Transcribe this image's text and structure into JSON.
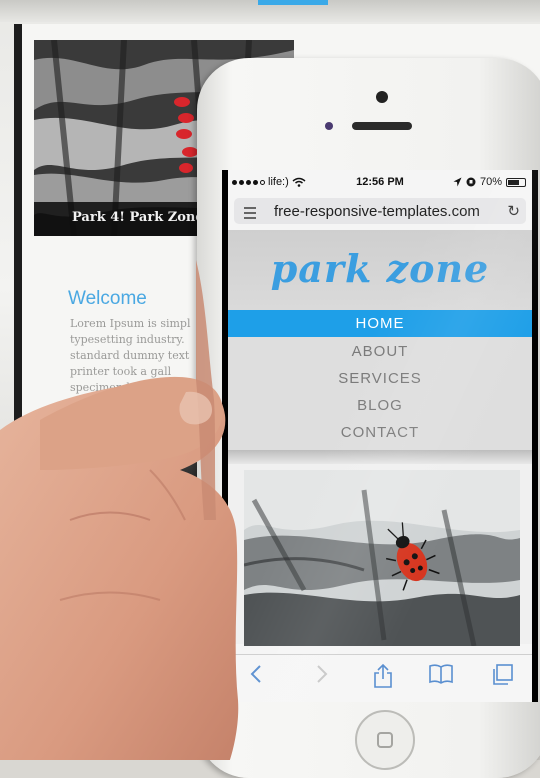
{
  "background_monitor": {
    "photo_caption": "Park 4! Park Zone d",
    "welcome_heading": "Welcome",
    "lorem_lines": [
      "Lorem Ipsum is simpl",
      "typesetting industry.",
      "standard dummy text",
      "printer took a gall",
      "specimen b"
    ]
  },
  "phone": {
    "status_bar": {
      "carrier": "life:)",
      "time": "12:56 PM",
      "battery": "70%",
      "battery_level": 0.7,
      "signal_bars": 4
    },
    "address_bar": {
      "url": "free-responsive-templates.com"
    },
    "site": {
      "logo": "park zone",
      "nav": [
        {
          "label": "HOME",
          "active": true
        },
        {
          "label": "ABOUT",
          "active": false
        },
        {
          "label": "SERVICES",
          "active": false
        },
        {
          "label": "BLOG",
          "active": false
        },
        {
          "label": "CONTACT",
          "active": false
        }
      ]
    },
    "toolbar_icons": [
      "back-icon",
      "forward-icon",
      "share-icon",
      "bookmarks-icon",
      "tabs-icon"
    ]
  },
  "colors": {
    "accent_blue": "#1e9fe8",
    "logo_blue": "#3b9ee0",
    "nav_text": "#7a7a7a"
  }
}
